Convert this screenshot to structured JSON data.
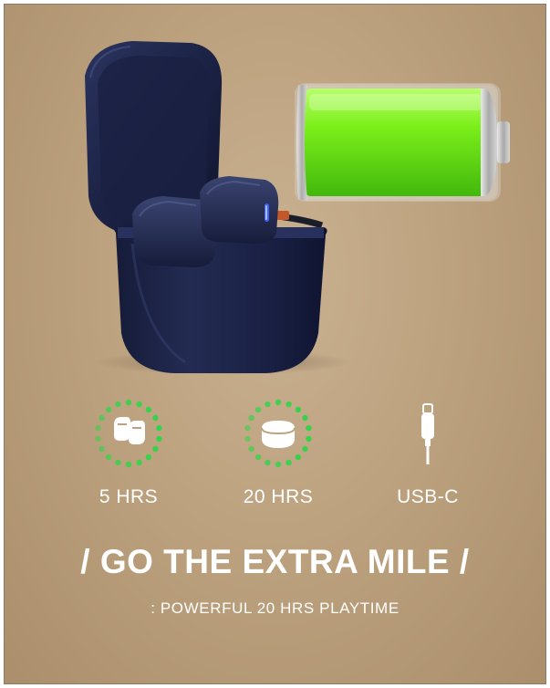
{
  "features": [
    {
      "icon": "earbuds-icon",
      "label": "5 HRS",
      "ring_color": "#36d24a"
    },
    {
      "icon": "charging-case-icon",
      "label": "20 HRS",
      "ring_color": "#36d24a"
    },
    {
      "icon": "usb-c-cable-icon",
      "label": "USB-C"
    }
  ],
  "headline": "/ GO THE EXTRA MILE /",
  "subheadline": ": POWERFUL 20 HRS PLAYTIME",
  "colors": {
    "background": "#bda27f",
    "case": "#1d2446",
    "battery_fill": "#7cef1a",
    "indicator": "#3d64ff",
    "text": "#ffffff"
  },
  "battery": {
    "level_percent": 100
  }
}
